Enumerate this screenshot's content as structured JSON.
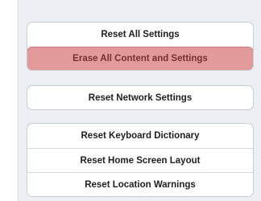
{
  "groups": [
    {
      "items": [
        {
          "label": "Reset All Settings"
        },
        {
          "label": "Erase All Content and Settings",
          "highlighted": true
        }
      ]
    },
    {
      "items": [
        {
          "label": "Reset Network Settings"
        }
      ]
    },
    {
      "items": [
        {
          "label": "Reset Keyboard Dictionary"
        },
        {
          "label": "Reset Home Screen Layout"
        },
        {
          "label": "Reset Location Warnings"
        }
      ]
    }
  ],
  "colors": {
    "highlight_bg": "#e39a9a",
    "highlight_text": "#7a3030",
    "panel_bg": "#eceff3"
  }
}
